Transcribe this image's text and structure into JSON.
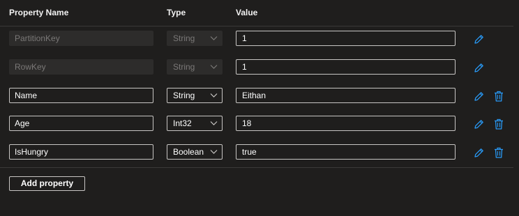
{
  "headers": {
    "property_name": "Property Name",
    "type": "Type",
    "value": "Value"
  },
  "rows": [
    {
      "name": "PartitionKey",
      "type": "String",
      "value": "1",
      "editable_name": false,
      "deletable": false
    },
    {
      "name": "RowKey",
      "type": "String",
      "value": "1",
      "editable_name": false,
      "deletable": false
    },
    {
      "name": "Name",
      "type": "String",
      "value": "Eithan",
      "editable_name": true,
      "deletable": true
    },
    {
      "name": "Age",
      "type": "Int32",
      "value": "18",
      "editable_name": true,
      "deletable": true
    },
    {
      "name": "IsHungry",
      "type": "Boolean",
      "value": "true",
      "editable_name": true,
      "deletable": true
    }
  ],
  "add_button_label": "Add property",
  "icons": {
    "edit": "pencil-icon",
    "delete": "trash-icon",
    "select": "chevron-down-icon"
  },
  "colors": {
    "background": "#1f1e1d",
    "accent": "#2899f5",
    "border": "#c8c6c4",
    "disabled": "#2d2c2b"
  }
}
